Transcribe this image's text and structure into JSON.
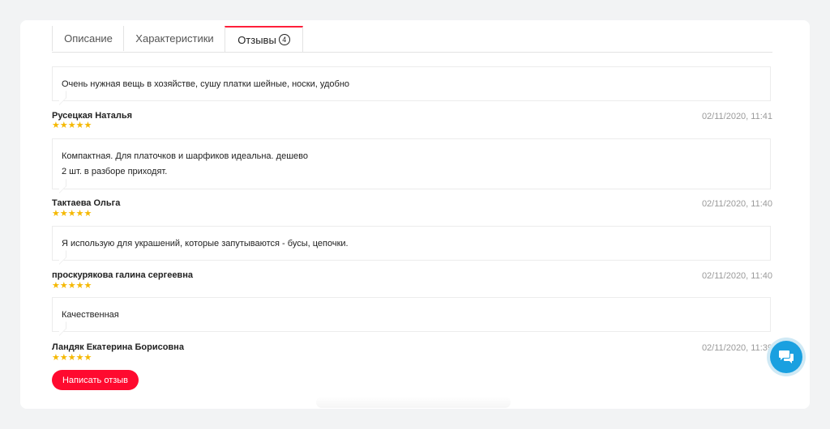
{
  "tabs": [
    {
      "label": "Описание"
    },
    {
      "label": "Характеристики"
    },
    {
      "label": "Отзывы",
      "count": "4"
    }
  ],
  "reviews": [
    {
      "text_lines": [
        "Очень нужная вещь в хозяйстве, сушу платки шейные, носки, удобно"
      ],
      "author": "Русецкая Наталья",
      "rating": "★★★★★",
      "date": "02/11/2020, 11:41"
    },
    {
      "text_lines": [
        "Компактная. Для платочков и шарфиков идеальна. дешево",
        "2 шт. в разборе приходят."
      ],
      "author": "Тактаева Ольга",
      "rating": "★★★★★",
      "date": "02/11/2020, 11:40"
    },
    {
      "text_lines": [
        "Я использую для украшений, которые запутываются - бусы, цепочки."
      ],
      "author": "проскурякова галина сергеевна",
      "rating": "★★★★★",
      "date": "02/11/2020, 11:40"
    },
    {
      "text_lines": [
        "Качественная"
      ],
      "author": "Ландяк Екатерина Борисовна",
      "rating": "★★★★★",
      "date": "02/11/2020, 11:39"
    }
  ],
  "actions": {
    "write_review": "Написать отзыв"
  },
  "icons": {
    "chat": "chat-bubbles-icon"
  },
  "colors": {
    "accent": "#ff0a2f",
    "stars": "#f5b800",
    "chat": "#1aa0e0"
  }
}
